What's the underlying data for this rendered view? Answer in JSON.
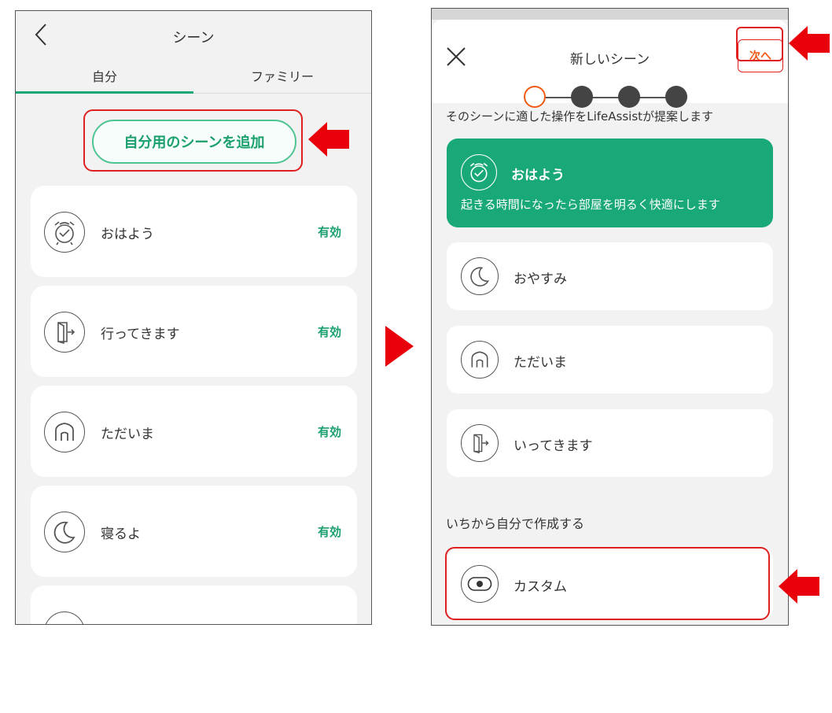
{
  "left_screen": {
    "title": "シーン",
    "tabs": [
      {
        "label": "自分"
      },
      {
        "label": "ファミリー"
      }
    ],
    "add_button_label": "自分用のシーンを追加",
    "scenes": [
      {
        "label": "おはよう",
        "status": "有効",
        "icon": "alarm-clock-icon"
      },
      {
        "label": "行ってきます",
        "status": "有効",
        "icon": "door-exit-icon"
      },
      {
        "label": "ただいま",
        "status": "有効",
        "icon": "house-icon"
      },
      {
        "label": "寝るよ",
        "status": "有効",
        "icon": "moon-icon"
      }
    ]
  },
  "right_screen": {
    "title": "新しいシーン",
    "next_label": "次へ",
    "description": "そのシーンに適した操作をLifeAssistが提案します",
    "featured": {
      "name": "おはよう",
      "description": "起きる時間になったら部屋を明るく快適にします",
      "icon": "alarm-clock-icon"
    },
    "templates": [
      {
        "label": "おやすみ",
        "icon": "moon-icon"
      },
      {
        "label": "ただいま",
        "icon": "house-icon"
      },
      {
        "label": "いってきます",
        "icon": "door-exit-icon"
      }
    ],
    "section_label": "いちから自分で作成する",
    "custom_label": "カスタム",
    "custom_icon": "toggle-icon"
  },
  "colors": {
    "accent_green": "#19a878",
    "status_green": "#19a06d",
    "highlight_red": "#e02020",
    "step_orange": "#f05a14"
  }
}
